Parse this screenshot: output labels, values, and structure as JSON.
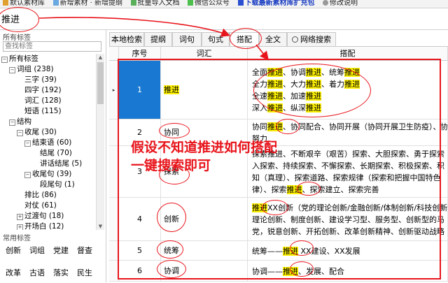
{
  "toolbar": {
    "items": [
      "默认素材库",
      "新增素材 · 新增提纲",
      "批量导入文档",
      "微信公众号",
      "下载最新素材库扩充包",
      "修改说明"
    ]
  },
  "search": {
    "value": "推进"
  },
  "sidebar": {
    "header": "所有标签",
    "filter_placeholder": "查找标签",
    "tree": [
      {
        "label": "所有标签",
        "toggle": "−"
      },
      {
        "label": "词组 (238)",
        "toggle": "−"
      },
      {
        "label": "三字 (39)"
      },
      {
        "label": "四字 (192)"
      },
      {
        "label": "词汇 (128)"
      },
      {
        "label": "短语 (115)"
      },
      {
        "label": "结构",
        "toggle": "−"
      },
      {
        "label": "收尾 (30)",
        "toggle": "−"
      },
      {
        "label": "结束语 (60)",
        "toggle": "−"
      },
      {
        "label": "结尾 (70)"
      },
      {
        "label": "讲话结尾 (5)"
      },
      {
        "label": "收尾句 (39)",
        "toggle": "−"
      },
      {
        "label": "段尾句 (1)"
      },
      {
        "label": "排比 (86)"
      },
      {
        "label": "对仗 (61)"
      },
      {
        "label": "过渡句 (18)",
        "toggle": "+"
      },
      {
        "label": "开场白 (12)",
        "toggle": "+"
      }
    ],
    "common_header": "常用标签",
    "common": [
      "创新",
      "词组",
      "党建",
      "督查",
      "改革",
      "古语",
      "落实",
      "民生"
    ]
  },
  "tabs": [
    "本地检索",
    "提纲",
    "词句",
    "句式",
    "搭配",
    "全文",
    "网络搜索"
  ],
  "active_tab": "搭配",
  "table": {
    "headers": [
      "序号",
      "词汇",
      "搭配"
    ],
    "rows": [
      {
        "num": "1",
        "word": "推进",
        "lines": [
          [
            {
              "t": "全面"
            },
            {
              "t": "推进",
              "h": true
            },
            {
              "t": "、协调"
            },
            {
              "t": "推进",
              "h": true
            },
            {
              "t": "、统筹"
            },
            {
              "t": "推进",
              "h": true
            }
          ],
          [
            {
              "t": "全力"
            },
            {
              "t": "推进",
              "h": true
            },
            {
              "t": "、大力"
            },
            {
              "t": "推进",
              "h": true
            },
            {
              "t": "、着力"
            },
            {
              "t": "推进",
              "h": true
            }
          ],
          [
            {
              "t": "全速"
            },
            {
              "t": "推进",
              "h": true
            },
            {
              "t": "、加速"
            },
            {
              "t": "推进",
              "h": true
            }
          ],
          [
            {
              "t": "深入"
            },
            {
              "t": "推进",
              "h": true
            },
            {
              "t": "、纵深"
            },
            {
              "t": "推进",
              "h": true
            }
          ]
        ]
      },
      {
        "num": "2",
        "word": "协同",
        "lines": [
          [
            {
              "t": "协同"
            },
            {
              "t": "推进",
              "h": true
            },
            {
              "t": "、协同配合、协同开展（协同开展卫生防疫）、协"
            }
          ],
          [
            {
              "t": "努力"
            }
          ]
        ]
      },
      {
        "num": "3",
        "word": "探索",
        "lines": [
          [
            {
              "t": "探索推进、不断艰辛（艰苦）探索、大胆探索、勇于探索"
            }
          ],
          [
            {
              "t": "入探索、持续探索、不懈探索、长期探索、积极探索、积"
            }
          ],
          [
            {
              "t": "知（真理）、探索道路、探索规律（探索和把握中国特色"
            }
          ],
          [
            {
              "t": "律）、探索"
            },
            {
              "t": "推进",
              "h": true
            },
            {
              "t": "、探索建立、探索完善"
            }
          ]
        ]
      },
      {
        "num": "4",
        "word": "创新",
        "lines": [
          [
            {
              "t": "推进",
              "h": true
            },
            {
              "t": "XX创新（党的理论创新/金融创新/体制创新/科技创新"
            }
          ],
          [
            {
              "t": "理论创新、制度创新、建设学习型、服务型、创新型的马"
            }
          ],
          [
            {
              "t": "党，锐意创新、开拓创新、改革创新精神、创新驱动战略"
            }
          ]
        ]
      },
      {
        "num": "5",
        "word": "统筹",
        "lines": [
          [
            {
              "t": "统筹——"
            },
            {
              "t": "推进",
              "h": true
            },
            {
              "t": " XX建设、XX发展"
            }
          ]
        ]
      },
      {
        "num": "6",
        "word": "协调",
        "lines": [
          [
            {
              "t": "协调——"
            },
            {
              "t": "推进",
              "h": true
            },
            {
              "t": "、发展、配合"
            }
          ]
        ]
      }
    ]
  },
  "annotation": {
    "line1": "假设不知道推进如何搭配",
    "line2": "一键搜索即可"
  },
  "colors": {
    "accent_red": "#e8141b",
    "highlight": "#fff200",
    "selection": "#1979d2"
  }
}
